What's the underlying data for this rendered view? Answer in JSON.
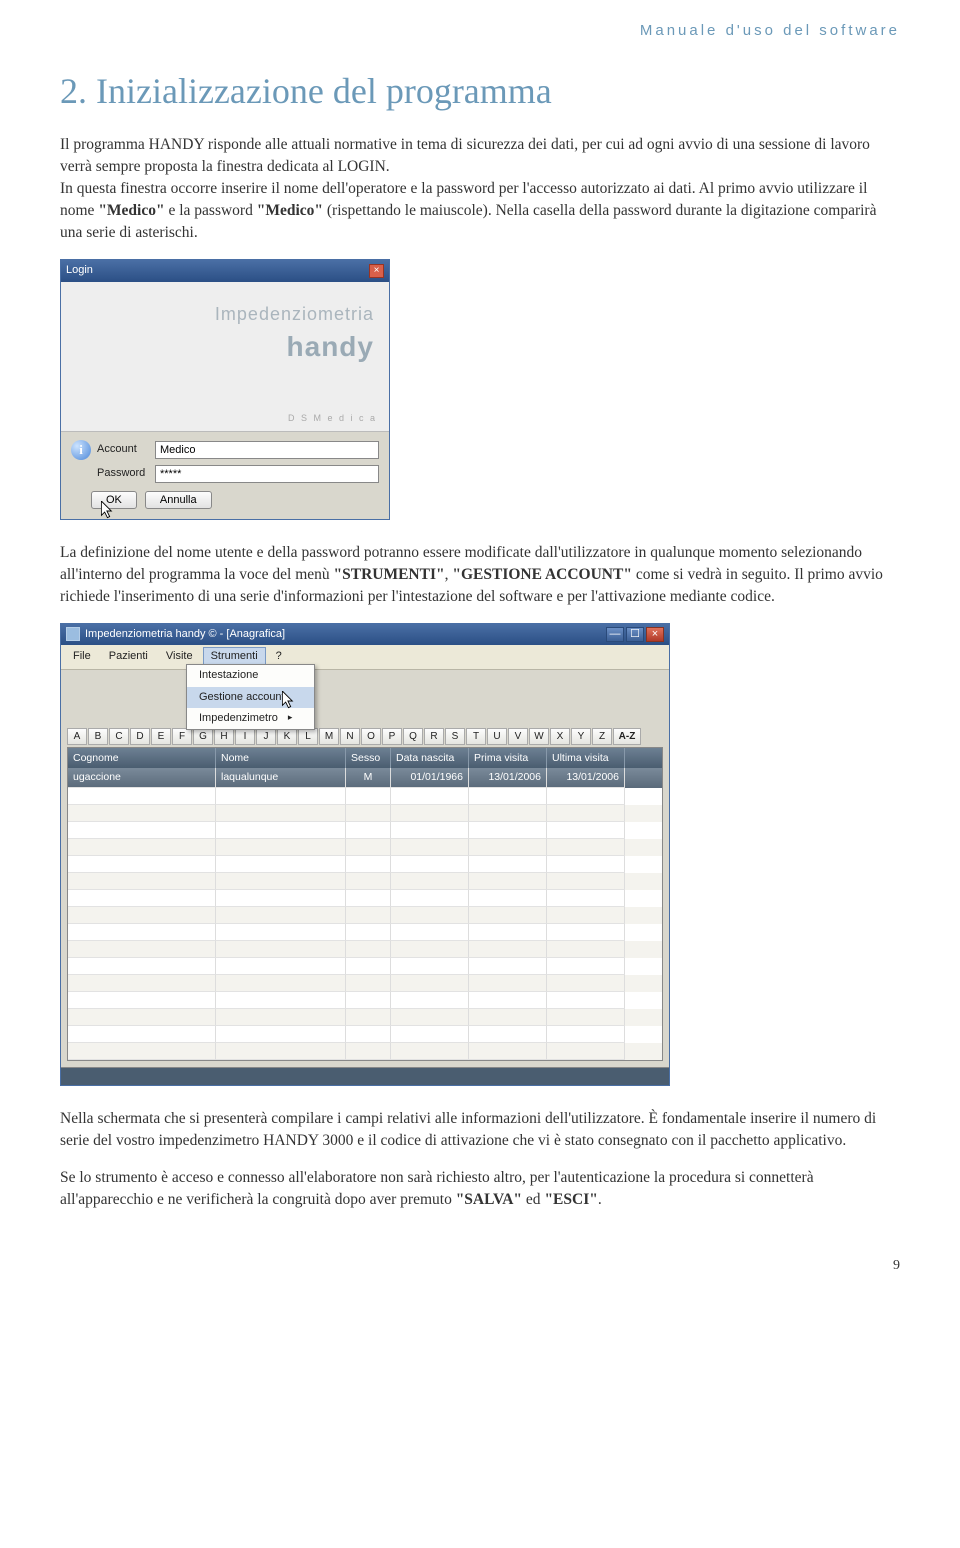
{
  "header": {
    "running_title": "Manuale d'uso del software"
  },
  "section": {
    "title": "2. Inizializzazione del programma"
  },
  "paragraphs": {
    "p1_a": "Il programma HANDY risponde alle attuali normative in tema di sicurezza dei dati, per cui ad ogni avvio di una sessione di lavoro verrà sempre proposta la finestra dedicata al LOGIN.",
    "p1_b": "In questa finestra occorre inserire il nome dell'operatore e la password per l'accesso autorizzato ai dati. Al primo avvio utilizzare il nome ",
    "p1_b_bold1": "\"Medico\"",
    "p1_b_mid": " e la password ",
    "p1_b_bold2": "\"Medico\"",
    "p1_b_end": " (rispettando le maiuscole). Nella casella della password durante la digitazione comparirà una serie di asterischi.",
    "p2_a": "La definizione del nome utente e della password potranno essere modificate dall'utilizzatore in qualunque momento selezionando all'interno del programma la voce del menù ",
    "p2_bold1": "\"STRUMENTI\"",
    "p2_mid": ", ",
    "p2_bold2": "\"GESTIONE ACCOUNT\"",
    "p2_b": " come si vedrà in seguito. Il primo avvio richiede l'inserimento di una serie d'informazioni per l'intestazione del software e per l'attivazione mediante codice.",
    "p3": "Nella schermata che si presenterà compilare i campi relativi alle informazioni dell'utilizzatore. È fondamentale inserire il numero di serie del vostro impedenzimetro HANDY 3000 e il codice di attivazione che vi è stato consegnato con il pacchetto applicativo.",
    "p4_a": "Se lo strumento è acceso e connesso all'elaboratore non sarà richiesto altro, per l'autenticazione la procedura si connetterà all'apparecchio e ne verificherà la congruità dopo aver premuto ",
    "p4_bold1": "\"SALVA\"",
    "p4_mid": " ed ",
    "p4_bold2": "\"ESCI\"",
    "p4_end": "."
  },
  "login": {
    "title": "Login",
    "banner_line1": "Impedenziometria",
    "banner_line2": "handy",
    "brand": "D S  M e d i c a",
    "account_label": "Account",
    "account_value": "Medico",
    "password_label": "Password",
    "password_value": "*****",
    "ok": "OK",
    "cancel": "Annulla"
  },
  "app": {
    "title": "Impedenziometria handy © - [Anagrafica]",
    "menu": {
      "file": "File",
      "pazienti": "Pazienti",
      "visite": "Visite",
      "strumenti": "Strumenti",
      "help": "?"
    },
    "dropdown": {
      "intestazione": "Intestazione",
      "gestione": "Gestione account",
      "impedenzimetro": "Impedenzimetro"
    },
    "alphabet": [
      "A",
      "B",
      "C",
      "D",
      "E",
      "F",
      "G",
      "H",
      "I",
      "J",
      "K",
      "L",
      "M",
      "N",
      "O",
      "P",
      "Q",
      "R",
      "S",
      "T",
      "U",
      "V",
      "W",
      "X",
      "Y",
      "Z",
      "A-Z"
    ],
    "columns": {
      "cognome": "Cognome",
      "nome": "Nome",
      "sesso": "Sesso",
      "nascita": "Data nascita",
      "prima": "Prima visita",
      "ultima": "Ultima visita"
    },
    "row": {
      "cognome": "ugaccione",
      "nome": "laqualunque",
      "sesso": "M",
      "nascita": "01/01/1966",
      "prima": "13/01/2006",
      "ultima": "13/01/2006"
    }
  },
  "page_number": "9"
}
